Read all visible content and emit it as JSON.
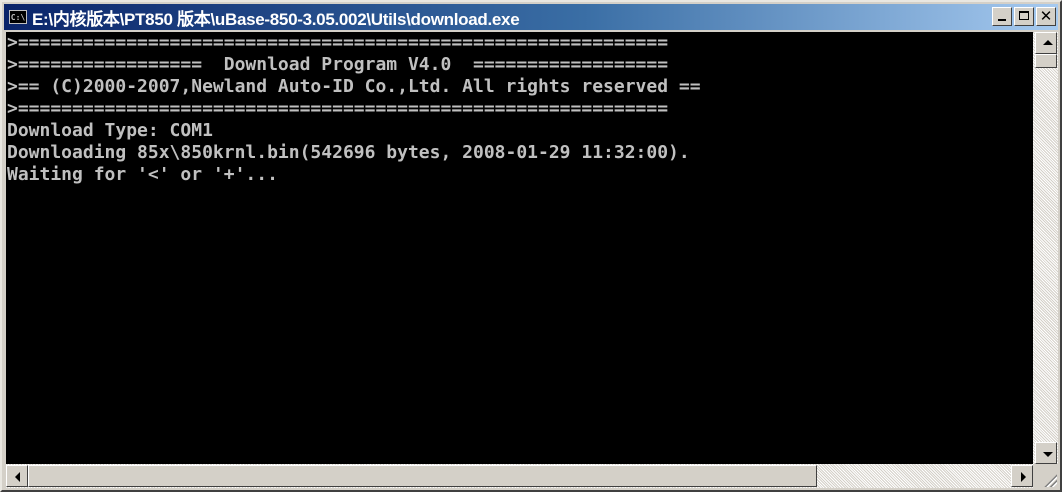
{
  "window": {
    "title": "E:\\内核版本\\PT850 版本\\uBase-850-3.05.002\\Utils\\download.exe",
    "icon": "cmd-icon",
    "icon_text": "C:\\"
  },
  "console": {
    "lines": [
      ">============================================================",
      ">=================  Download Program V4.0  ==================",
      ">== (C)2000-2007,Newland Auto-ID Co.,Ltd. All rights reserved ==",
      ">============================================================",
      "Download Type: COM1",
      "Downloading 85x\\850krnl.bin(542696 bytes, 2008-01-29 11:32:00).",
      "Waiting for '<' or '+'..."
    ],
    "text_color": "#c0c0c0",
    "background_color": "#000000"
  },
  "colors": {
    "titlebar_start": "#0a246a",
    "titlebar_end": "#a6caf0",
    "chrome": "#d4d0c8"
  }
}
